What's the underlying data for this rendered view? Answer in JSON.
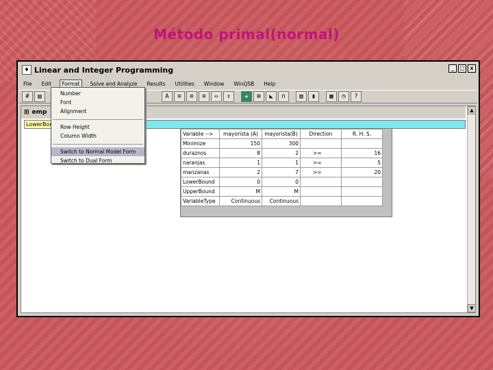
{
  "slide": {
    "title": "Método primal(normal)"
  },
  "window": {
    "title": "Linear and Integer Programming",
    "controls": [
      "_",
      "□",
      "x"
    ]
  },
  "menubar": {
    "items": [
      "File",
      "Edit",
      "Format",
      "Solve and Analyze",
      "Results",
      "Utilities",
      "Window",
      "WinQSB",
      "Help"
    ]
  },
  "format_menu": {
    "items_group1": [
      "Number",
      "Font",
      "Alignment"
    ],
    "items_group2": [
      "Row Height",
      "Column Width"
    ],
    "items_group3": [
      "Switch to Normal Model Form",
      "Switch to Dual Form"
    ],
    "selected": "Switch to Normal Model Form"
  },
  "document": {
    "title": "emp",
    "cell_ref": "LowerBound"
  },
  "table": {
    "headers": [
      "Variable -->",
      "mayorista (A)",
      "mayorista(B)",
      "Direction",
      "R. H. S."
    ],
    "rows": [
      [
        "Minimize",
        "150",
        "300",
        "",
        ""
      ],
      [
        "duraznos",
        "8",
        "2",
        ">=",
        "16"
      ],
      [
        "naranjas",
        "1",
        "1",
        ">=",
        "5"
      ],
      [
        "manzanas",
        "2",
        "7",
        ">=",
        "20"
      ],
      [
        "LowerBound",
        "0",
        "0",
        "",
        ""
      ],
      [
        "UpperBound",
        "M",
        "M",
        "",
        ""
      ],
      [
        "VariableType",
        "Continuous",
        "Continuous",
        "",
        ""
      ]
    ]
  }
}
